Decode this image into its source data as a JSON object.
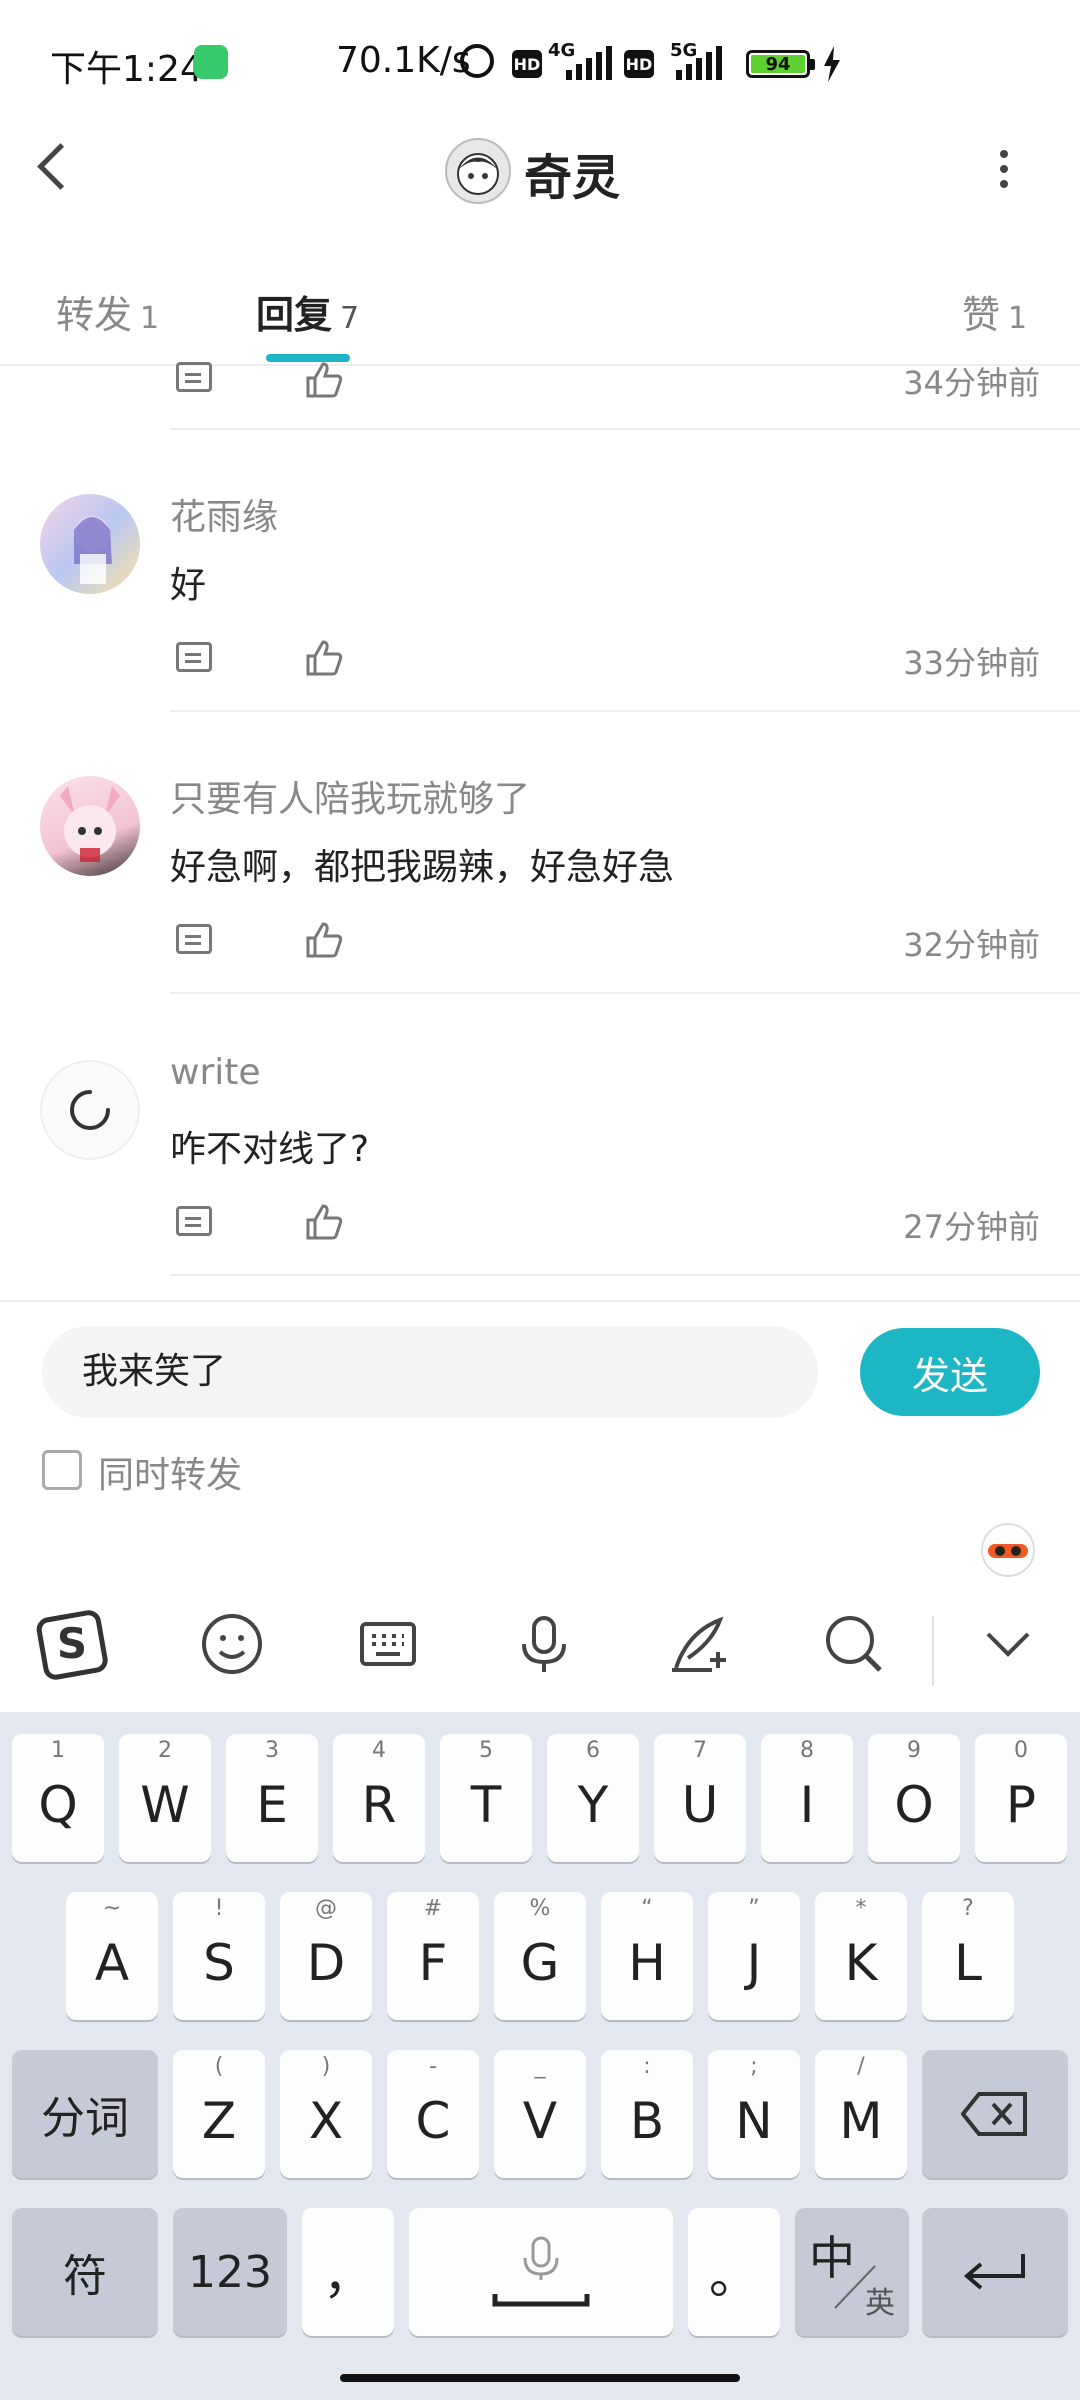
{
  "status_bar": {
    "time": "下午1:24",
    "net_speed": "70.1K/s",
    "hd": "HD",
    "sim1": "4G",
    "sim2": "5G",
    "battery": "94",
    "colors": {
      "battery_fill": "#5cd130",
      "app_icon": "#38c96b"
    }
  },
  "header": {
    "title": "奇灵",
    "back_icon": "chevron-left-icon",
    "more_icon": "more-vertical-icon"
  },
  "tabs": [
    {
      "label": "转发",
      "count": "1"
    },
    {
      "label": "回复",
      "count": "7",
      "active": true
    },
    {
      "label": "赞",
      "count": "1"
    }
  ],
  "comments": [
    {
      "name": "",
      "text": "",
      "time": "34分钟前"
    },
    {
      "name": "花雨缘",
      "text": "好",
      "time": "33分钟前"
    },
    {
      "name": "只要有人陪我玩就够了",
      "text": "好急啊，都把我踢辣，好急好急",
      "time": "32分钟前"
    },
    {
      "name": "write",
      "text": "咋不对线了?",
      "time": "27分钟前"
    }
  ],
  "composer": {
    "input_value": "我来笑了",
    "send_label": "发送",
    "checkbox_label": "同时转发",
    "accent": "#1cb6c4"
  },
  "keyboard": {
    "toolbar": [
      "sogou-logo-icon",
      "emoji-icon",
      "keyboard-icon",
      "microphone-icon",
      "handwriting-icon",
      "search-icon",
      "collapse-chevron-icon"
    ],
    "row1": [
      {
        "k": "Q",
        "h": "1"
      },
      {
        "k": "W",
        "h": "2"
      },
      {
        "k": "E",
        "h": "3"
      },
      {
        "k": "R",
        "h": "4"
      },
      {
        "k": "T",
        "h": "5"
      },
      {
        "k": "Y",
        "h": "6"
      },
      {
        "k": "U",
        "h": "7"
      },
      {
        "k": "I",
        "h": "8"
      },
      {
        "k": "O",
        "h": "9"
      },
      {
        "k": "P",
        "h": "0"
      }
    ],
    "row2": [
      {
        "k": "A",
        "h": "~"
      },
      {
        "k": "S",
        "h": "!"
      },
      {
        "k": "D",
        "h": "@"
      },
      {
        "k": "F",
        "h": "#"
      },
      {
        "k": "G",
        "h": "%"
      },
      {
        "k": "H",
        "h": "“"
      },
      {
        "k": "J",
        "h": "”"
      },
      {
        "k": "K",
        "h": "*"
      },
      {
        "k": "L",
        "h": "?"
      }
    ],
    "row3": [
      {
        "k": "Z",
        "h": "("
      },
      {
        "k": "X",
        "h": ")"
      },
      {
        "k": "C",
        "h": "-"
      },
      {
        "k": "V",
        "h": "_"
      },
      {
        "k": "B",
        "h": ":"
      },
      {
        "k": "N",
        "h": ";"
      },
      {
        "k": "M",
        "h": "/"
      }
    ],
    "fenci": "分词",
    "fu": "符",
    "num": "123",
    "comma": "，",
    "period": "。",
    "lang_main": "中",
    "lang_sub": "英"
  }
}
